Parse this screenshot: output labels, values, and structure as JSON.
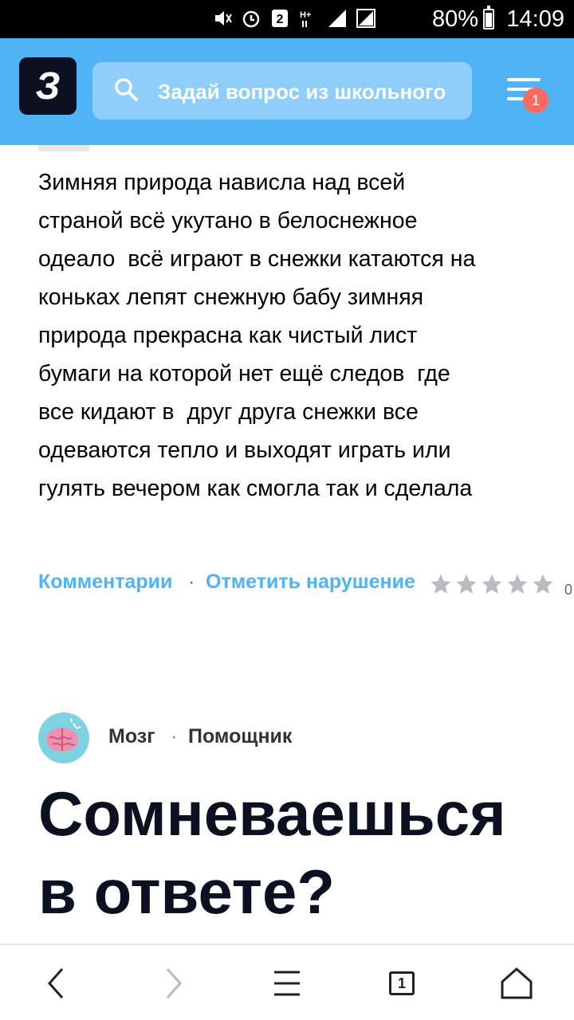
{
  "status_bar": {
    "battery_percent": "80%",
    "time": "14:09",
    "sim_badge": "2",
    "icons": [
      "mute-icon",
      "alarm-icon",
      "sim-2-icon",
      "h-plus-icon",
      "signal-icon",
      "signal-icon",
      "battery-icon"
    ]
  },
  "header": {
    "logo_letter": "З",
    "search_placeholder": "Задай вопрос из школьного",
    "menu_badge": "1",
    "colors": {
      "header_bg": "#4fb3f6",
      "search_bg": "#8fcefa",
      "logo_bg": "#0b1121",
      "badge": "#ff6b5e"
    }
  },
  "answer": {
    "text": "Зимняя природа нависла над всей\nстраной всё укутано в белоснежное\nодеало  всё играют в снежки катаются на\nконьках лепят снежную бабу зимняя\nприрода прекрасна как чистый лист\nбумаги на которой нет ещё следов  где\nвсе кидают в  друг друга снежки все\nодеваются тепло и выходят играть или\nгулять вечером как смогла так и сделала",
    "comments_label": "Комментарии",
    "separator": "·",
    "report_label": "Отметить нарушение",
    "stars_total": 5,
    "stars_filled": 0,
    "rating_count": "0"
  },
  "helper": {
    "name": "Мозг",
    "separator": "·",
    "role": "Помощник",
    "headline": "Сомневаешься в ответе?"
  },
  "bottom_nav": {
    "tabs_count": "1",
    "items": [
      "back-icon",
      "forward-icon",
      "menu-icon",
      "tabs-icon",
      "home-icon"
    ]
  }
}
